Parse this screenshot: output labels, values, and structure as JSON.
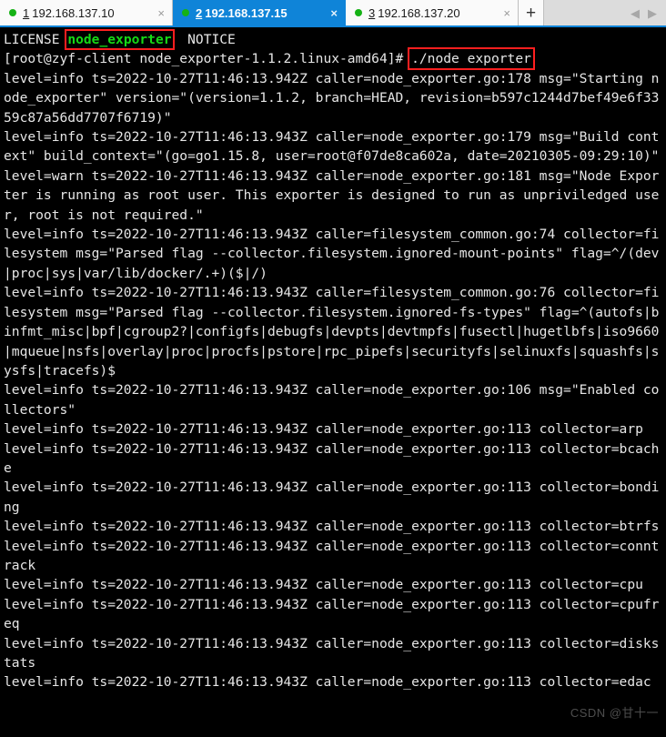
{
  "window": {
    "accent_color": "#0f84d8",
    "tabbar_bg": "#dcdcdc",
    "terminal_bg": "#000000",
    "terminal_fg": "#e6e6e6",
    "highlight_box_color": "#ff1f1f",
    "green_text_color": "#16d916",
    "status_dot_color": "#15b215"
  },
  "tabs": [
    {
      "index": "1",
      "label": "192.168.137.10",
      "close_label": "×",
      "active": false
    },
    {
      "index": "2",
      "label": "192.168.137.15",
      "close_label": "×",
      "active": true
    },
    {
      "index": "3",
      "label": "192.168.137.20",
      "close_label": "×",
      "active": false
    }
  ],
  "tabbar": {
    "new_tab_label": "+",
    "prev_arrow": "◀",
    "next_arrow": "▶"
  },
  "terminal": {
    "ls_output": {
      "item1": "LICENSE",
      "item2": "node_exporter",
      "item3": "NOTICE"
    },
    "prompt": {
      "text": "[root@zyf-client node_exporter-1.1.2.linux-amd64]# ",
      "command": "./node exporter"
    },
    "log_lines": [
      "level=info ts=2022-10-27T11:46:13.942Z caller=node_exporter.go:178 msg=\"Starting node_exporter\" version=\"(version=1.1.2, branch=HEAD, revision=b597c1244d7bef49e6f3359c87a56dd7707f6719)\"",
      "level=info ts=2022-10-27T11:46:13.943Z caller=node_exporter.go:179 msg=\"Build context\" build_context=\"(go=go1.15.8, user=root@f07de8ca602a, date=20210305-09:29:10)\"",
      "level=warn ts=2022-10-27T11:46:13.943Z caller=node_exporter.go:181 msg=\"Node Exporter is running as root user. This exporter is designed to run as unpriviledged user, root is not required.\"",
      "level=info ts=2022-10-27T11:46:13.943Z caller=filesystem_common.go:74 collector=filesystem msg=\"Parsed flag --collector.filesystem.ignored-mount-points\" flag=^/(dev|proc|sys|var/lib/docker/.+)($|/)",
      "level=info ts=2022-10-27T11:46:13.943Z caller=filesystem_common.go:76 collector=filesystem msg=\"Parsed flag --collector.filesystem.ignored-fs-types\" flag=^(autofs|binfmt_misc|bpf|cgroup2?|configfs|debugfs|devpts|devtmpfs|fusectl|hugetlbfs|iso9660|mqueue|nsfs|overlay|proc|procfs|pstore|rpc_pipefs|securityfs|selinuxfs|squashfs|sysfs|tracefs)$",
      "level=info ts=2022-10-27T11:46:13.943Z caller=node_exporter.go:106 msg=\"Enabled collectors\"",
      "level=info ts=2022-10-27T11:46:13.943Z caller=node_exporter.go:113 collector=arp",
      "level=info ts=2022-10-27T11:46:13.943Z caller=node_exporter.go:113 collector=bcache",
      "level=info ts=2022-10-27T11:46:13.943Z caller=node_exporter.go:113 collector=bonding",
      "level=info ts=2022-10-27T11:46:13.943Z caller=node_exporter.go:113 collector=btrfs",
      "level=info ts=2022-10-27T11:46:13.943Z caller=node_exporter.go:113 collector=conntrack",
      "level=info ts=2022-10-27T11:46:13.943Z caller=node_exporter.go:113 collector=cpu",
      "level=info ts=2022-10-27T11:46:13.943Z caller=node_exporter.go:113 collector=cpufreq",
      "level=info ts=2022-10-27T11:46:13.943Z caller=node_exporter.go:113 collector=diskstats",
      "level=info ts=2022-10-27T11:46:13.943Z caller=node_exporter.go:113 collector=edac"
    ],
    "watermark": "CSDN @甘十一"
  }
}
